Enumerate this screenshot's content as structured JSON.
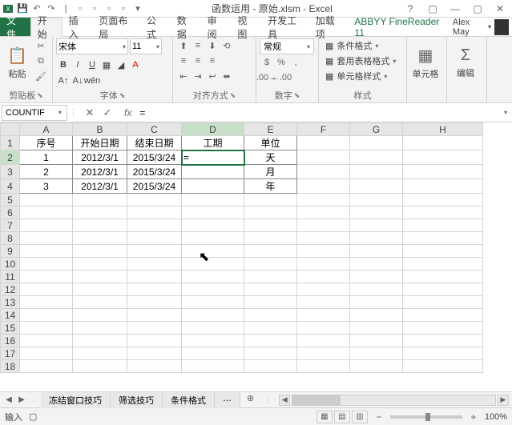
{
  "window": {
    "title": "函数运用 - 原始.xlsm - Excel",
    "user": "Alex May"
  },
  "ribbon": {
    "tabs": {
      "file": "文件",
      "home": "开始",
      "insert": "插入",
      "layout": "页面布局",
      "formulas": "公式",
      "data": "数据",
      "review": "审阅",
      "view": "视图",
      "developer": "开发工具",
      "addins": "加载项",
      "abbyy": "ABBYY FineReader 11"
    },
    "clipboard": {
      "label": "剪贴板",
      "paste": "粘贴"
    },
    "font": {
      "label": "字体",
      "name": "宋体",
      "size": "11"
    },
    "alignment": {
      "label": "对齐方式"
    },
    "number": {
      "label": "数字",
      "format": "常规"
    },
    "styles": {
      "label": "样式",
      "conditional": "条件格式",
      "table_format": "套用表格格式",
      "cell_styles": "单元格样式"
    },
    "cells": {
      "label": "单元格"
    },
    "editing": {
      "label": "编辑"
    }
  },
  "formula_bar": {
    "name_box": "COUNTIF",
    "formula": "="
  },
  "grid": {
    "columns": [
      "A",
      "B",
      "C",
      "D",
      "E",
      "F",
      "G",
      "H"
    ],
    "headers": {
      "A": "序号",
      "B": "开始日期",
      "C": "结束日期",
      "D": "工期",
      "E": "单位"
    },
    "rows": [
      {
        "A": "1",
        "B": "2012/3/1",
        "C": "2015/3/24",
        "D": "=",
        "E": "天"
      },
      {
        "A": "2",
        "B": "2012/3/1",
        "C": "2015/3/24",
        "D": "",
        "E": "月"
      },
      {
        "A": "3",
        "B": "2012/3/1",
        "C": "2015/3/24",
        "D": "",
        "E": "年"
      }
    ],
    "active_cell": "D2"
  },
  "sheets": {
    "items": [
      "冻结窗口技巧",
      "筛选技巧",
      "条件格式"
    ]
  },
  "status": {
    "mode": "输入",
    "zoom": "100%"
  }
}
